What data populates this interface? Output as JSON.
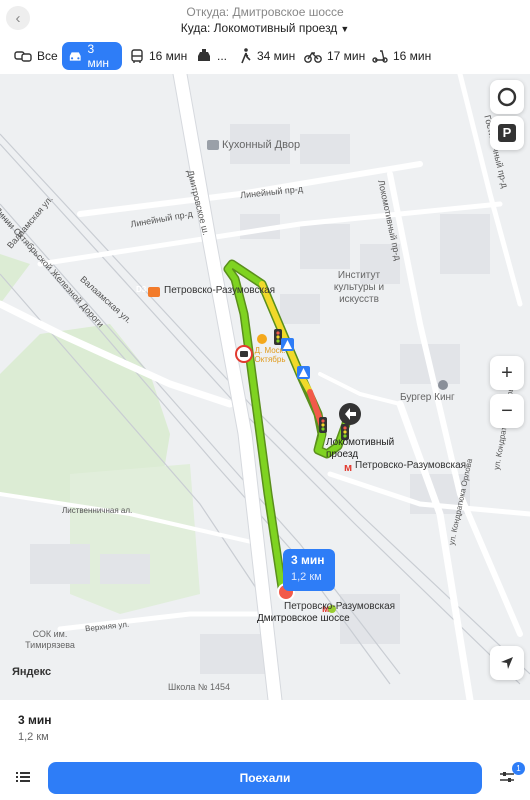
{
  "header": {
    "from": "Откуда: Дмитровское шоссе",
    "to": "Куда: Локомотивный проезд"
  },
  "modes": [
    {
      "label": "Все",
      "icon": "car-bus-icon"
    },
    {
      "label": "3 мин",
      "icon": "car-icon",
      "active": true
    },
    {
      "label": "16 мин",
      "icon": "bus-icon"
    },
    {
      "label": "...",
      "icon": "taxi-icon"
    },
    {
      "label": "34 мин",
      "icon": "walk-icon"
    },
    {
      "label": "17 мин",
      "icon": "bike-icon"
    },
    {
      "label": "16 мин",
      "icon": "scooter-icon"
    }
  ],
  "map": {
    "labels": {
      "kuhonny": "Кухонный Двор",
      "lineyny1": "Линейный пр-д",
      "lineyny2": "Линейный пр-д",
      "oktyabr": "ул. Линии Октябрьской Железной Дороги",
      "valaamskaya": "Валаамская ул.",
      "valaamskaya2": "Валаамская ул.",
      "dmitrovskoe": "Дмитровское ш.",
      "lokomotivny_street": "Локомотивный пр-д",
      "gostinichny": "Гостиничный пр-д",
      "institute": "Институт культуры и искусств",
      "petrovsko_d3": "Петровско-Разумовская",
      "d3": "D3",
      "poi_marker": "Д. Моск. Октябрь",
      "burger": "Бургер Кинг",
      "lokomotivny_dest": "Локомотивный проезд",
      "metro1": "Петровско-Разумовская",
      "metro2": "Петровско-Разумовская",
      "dmitrovskoe_start": "Дмитровское шоссе",
      "listvennichnaya": "Лиственничная ал.",
      "verhnyaya": "Верхняя ул.",
      "sok": "СОК им. Тимирязева",
      "school": "Школа № 1454",
      "kondratyuka": "ул. Кондратюка Орлова",
      "kondratyuka2": "ул. Кондратюка Орлова"
    },
    "route": {
      "time": "3 мин",
      "distance": "1,2 км"
    },
    "attribution": "Яндекс",
    "parking_label": "P",
    "zoom_in": "+",
    "zoom_out": "−"
  },
  "panel": {
    "time": "3 мин",
    "distance": "1,2 км",
    "go_label": "Поехали",
    "filter_badge": "1"
  },
  "colors": {
    "accent": "#2e7df7",
    "route_green": "#7fd321",
    "route_yellow": "#f1d92a",
    "route_red": "#f25a4a"
  }
}
